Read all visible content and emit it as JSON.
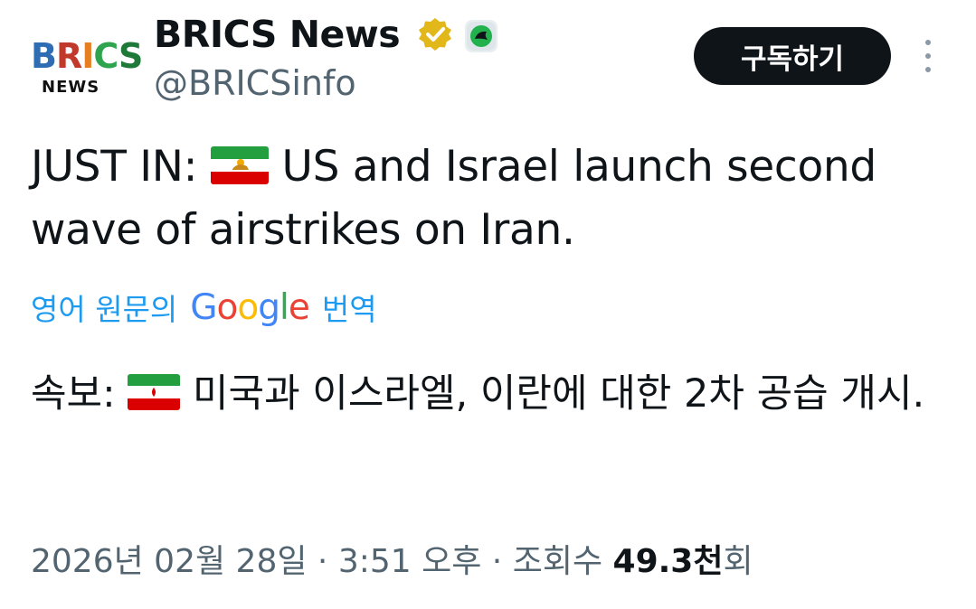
{
  "author": {
    "avatar_line1": "BRICS",
    "avatar_line2": "NEWS",
    "name": "BRICS News",
    "handle": "@BRICSinfo"
  },
  "actions": {
    "subscribe_label": "구독하기",
    "more_icon": "more-vertical-icon"
  },
  "post": {
    "text_prefix": "JUST IN: ",
    "text_main": " US and Israel launch second wave of airstrikes on Iran.",
    "translate_prefix": "영어 원문의",
    "translate_brand": "Google",
    "translate_suffix": "번역",
    "translated_prefix": "속보: ",
    "translated_main": " 미국과 이스라엘, 이란에 대한 2차 공습 개시."
  },
  "meta": {
    "date": "2026년 02월 28일",
    "sep1": " · ",
    "time": "3:51 오후",
    "sep2": " · ",
    "views_label": "조회수 ",
    "views_count": "49.3천",
    "views_suffix": "회"
  },
  "colors": {
    "accent": "#1d9bf0",
    "text": "#0f1419",
    "secondary": "#536471",
    "verified": "#e2b719"
  }
}
